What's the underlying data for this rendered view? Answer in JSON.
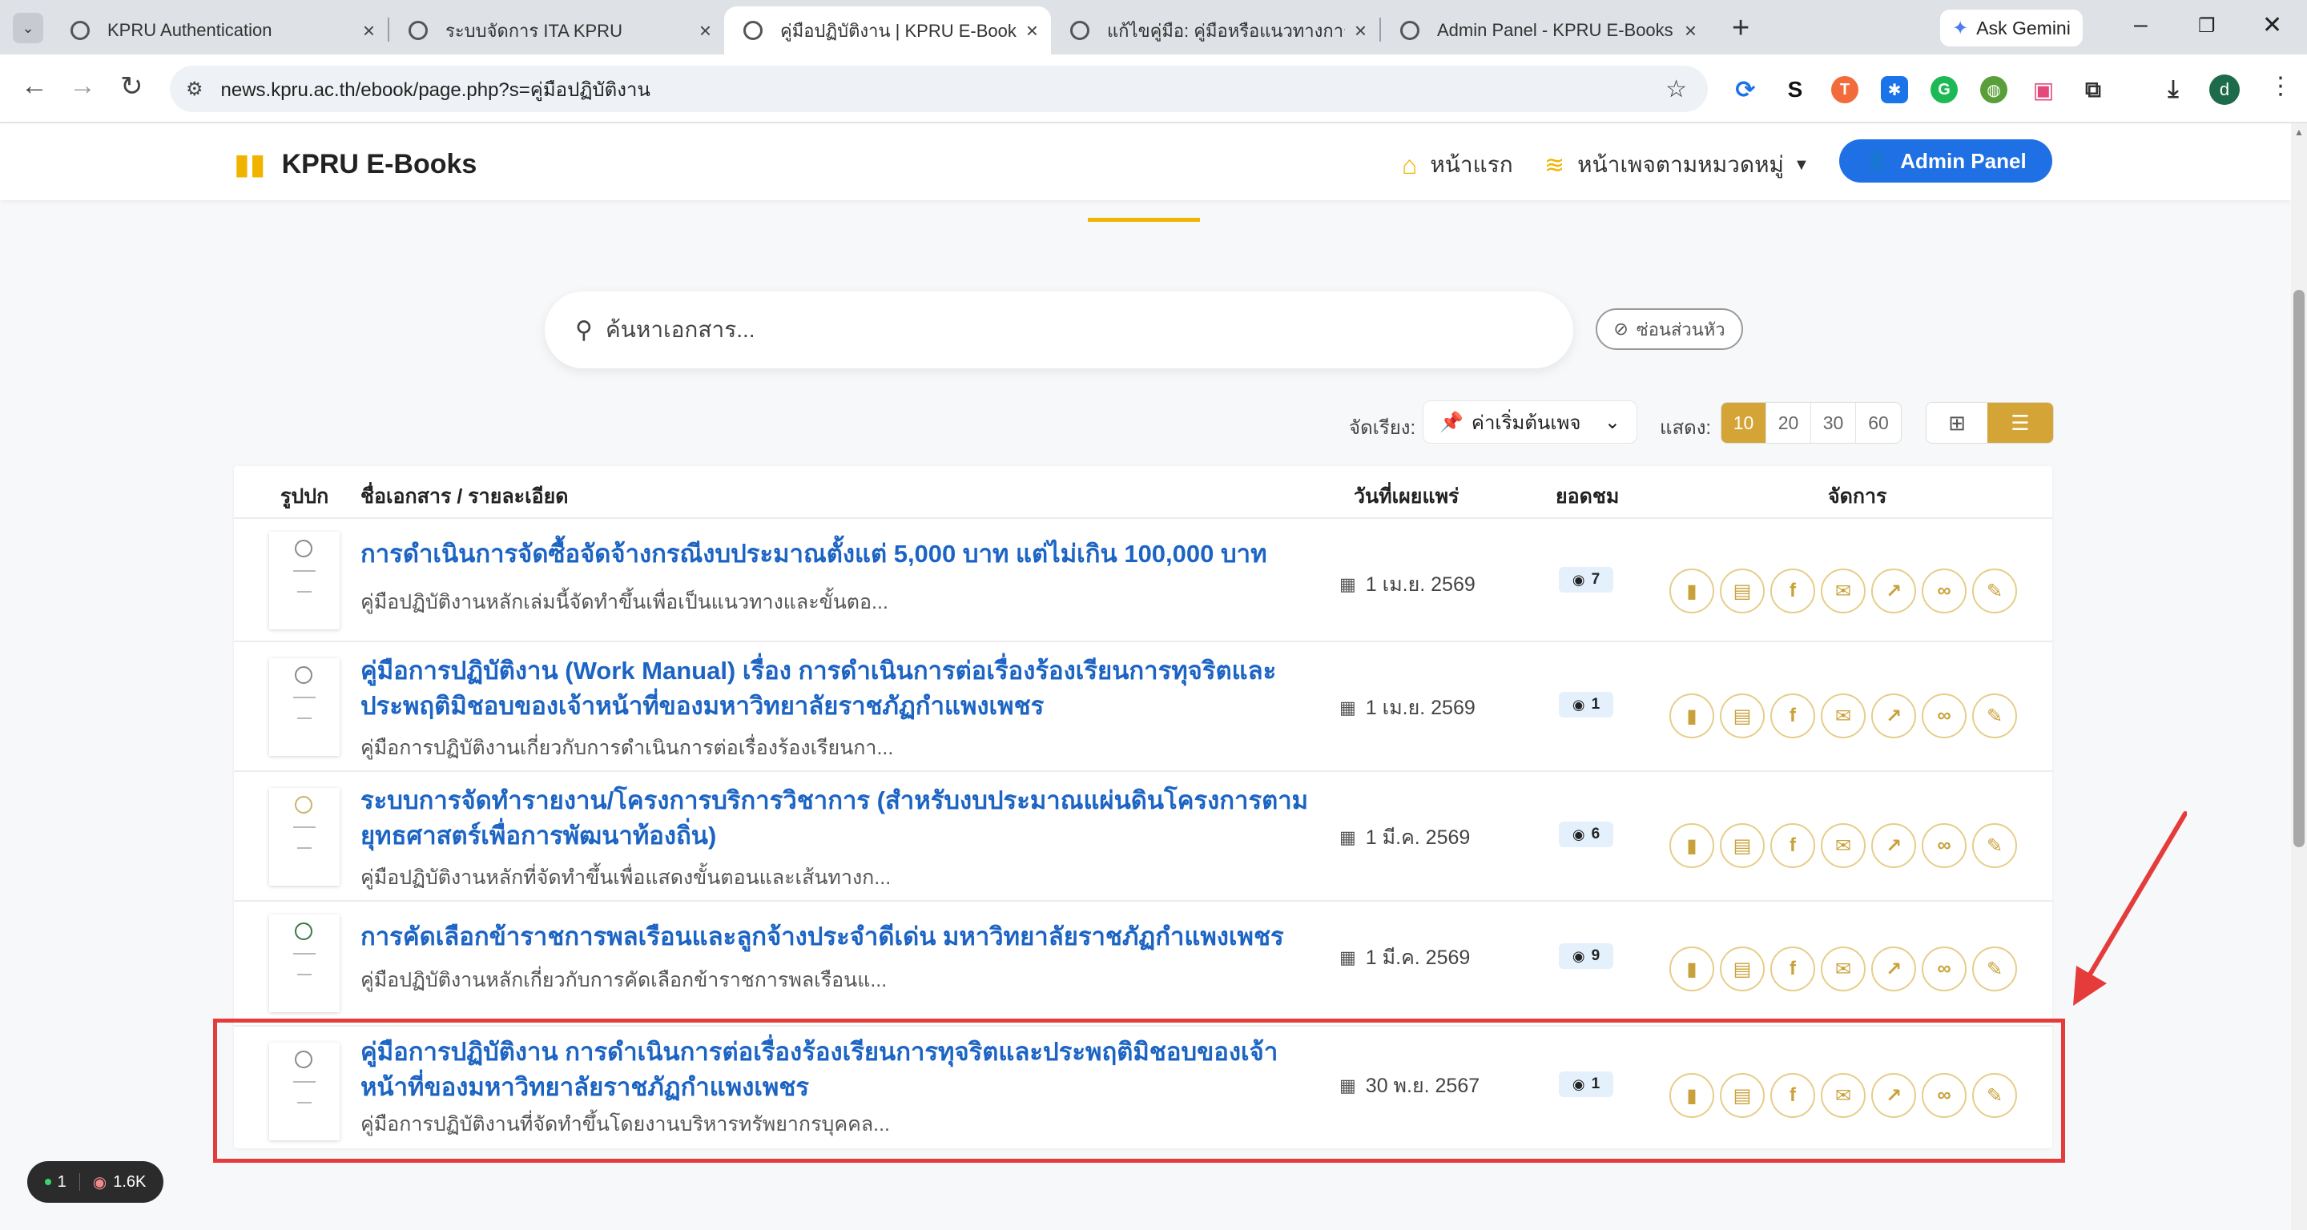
{
  "browser": {
    "tabs": [
      {
        "title": "KPRU Authentication",
        "active": false
      },
      {
        "title": "ระบบจัดการ ITA KPRU",
        "active": false
      },
      {
        "title": "คู่มือปฏิบัติงาน | KPRU E-Book Library",
        "active": true
      },
      {
        "title": "แก้ไขคู่มือ: คู่มือหรือแนวทางการปฏิบัติงาน",
        "active": false
      },
      {
        "title": "Admin Panel - KPRU E-Books",
        "active": false
      }
    ],
    "gemini_label": "Ask Gemini",
    "url": "news.kpru.ac.th/ebook/page.php?s=คู่มือปฏิบัติงาน",
    "profile_initial": "d"
  },
  "header": {
    "logo_text": "KPRU E-Books",
    "nav_home": "หน้าแรก",
    "nav_category": "หน้าเพจตามหมวดหมู่",
    "admin_button": "Admin Panel"
  },
  "search": {
    "placeholder": "ค้นหาเอกสาร...",
    "hide_header_label": "ซ่อนส่วนหัว"
  },
  "controls": {
    "sort_label": "จัดเรียง:",
    "sort_value": "ค่าเริ่มต้นเพจ",
    "show_label": "แสดง:",
    "page_sizes": [
      "10",
      "20",
      "30",
      "60"
    ],
    "selected_page_size": "10",
    "view_mode": "list"
  },
  "table": {
    "headers": {
      "cover": "รูปปก",
      "title": "ชื่อเอกสาร / รายละเอียด",
      "date": "วันที่เผยแพร่",
      "views": "ยอดชม",
      "actions": "จัดการ"
    },
    "rows": [
      {
        "title": "การดำเนินการจัดซื้อจัดจ้างกรณีงบประมาณตั้งแต่ 5,000 บาท แต่ไม่เกิน 100,000 บาท",
        "description": "คู่มือปฏิบัติงานหลักเล่มนี้จัดทำขึ้นเพื่อเป็นแนวทางและขั้นตอ...",
        "date": "1 เม.ย. 2569",
        "views": "7"
      },
      {
        "title": "คู่มือการปฏิบัติงาน (Work Manual) เรื่อง การดำเนินการต่อเรื่องร้องเรียนการทุจริตและประพฤติมิชอบของเจ้าหน้าที่ของมหาวิทยาลัยราชภัฏกำแพงเพชร",
        "description": "คู่มือการปฏิบัติงานเกี่ยวกับการดำเนินการต่อเรื่องร้องเรียนกา...",
        "date": "1 เม.ย. 2569",
        "views": "1"
      },
      {
        "title": "ระบบการจัดทำรายงาน/โครงการบริการวิชาการ (สำหรับงบประมาณแผ่นดินโครงการตามยุทธศาสตร์เพื่อการพัฒนาท้องถิ่น)",
        "description": "คู่มือปฏิบัติงานหลักที่จัดทำขึ้นเพื่อแสดงขั้นตอนและเส้นทางก...",
        "date": "1 มี.ค. 2569",
        "views": "6"
      },
      {
        "title": "การคัดเลือกข้าราชการพลเรือนและลูกจ้างประจำดีเด่น มหาวิทยาลัยราชภัฏกำแพงเพชร",
        "description": "คู่มือปฏิบัติงานหลักเกี่ยวกับการคัดเลือกข้าราชการพลเรือนแ...",
        "date": "1 มี.ค. 2569",
        "views": "9"
      },
      {
        "title": "คู่มือการปฏิบัติงาน การดำเนินการต่อเรื่องร้องเรียนการทุจริตและประพฤติมิชอบของเจ้าหน้าที่ของมหาวิทยาลัยราชภัฏกำแพงเพชร",
        "description": "คู่มือการปฏิบัติงานที่จัดทำขึ้นโดยงานบริหารทรัพยากรบุคคล...",
        "date": "30 พ.ย. 2567",
        "views": "1"
      }
    ],
    "action_icons": [
      "book-icon",
      "pdf-icon",
      "facebook-icon",
      "email-icon",
      "external-link-icon",
      "link-icon",
      "edit-icon"
    ]
  },
  "status_badge": {
    "online": "1",
    "views": "1.6K"
  },
  "colors": {
    "accent_gold": "#d4a437",
    "link_blue": "#1c64c4",
    "admin_blue": "#1f6fe5",
    "highlight_red": "#e53b3b"
  }
}
